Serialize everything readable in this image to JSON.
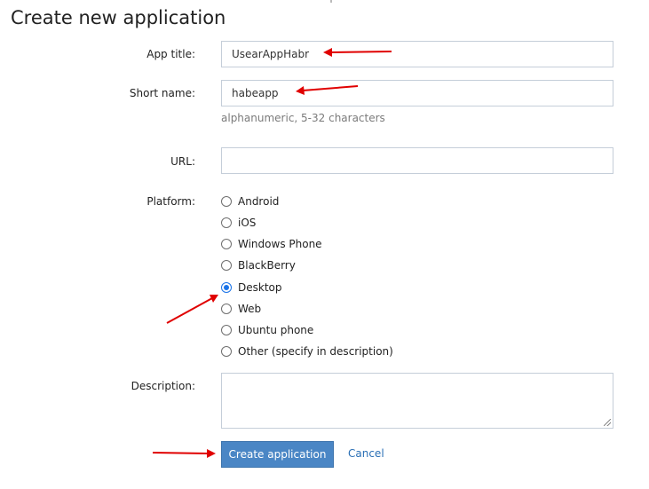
{
  "page": {
    "title": "Create new application"
  },
  "form": {
    "app_title": {
      "label": "App title:",
      "value": "UsearAppHabr"
    },
    "short_name": {
      "label": "Short name:",
      "value": "habeapp",
      "hint": "alphanumeric, 5-32 characters"
    },
    "url": {
      "label": "URL:",
      "value": ""
    },
    "platform": {
      "label": "Platform:",
      "options": [
        "Android",
        "iOS",
        "Windows Phone",
        "BlackBerry",
        "Desktop",
        "Web",
        "Ubuntu phone",
        "Other (specify in description)"
      ],
      "selected": "Desktop"
    },
    "description": {
      "label": "Description:",
      "value": ""
    },
    "submit_label": "Create application",
    "cancel_label": "Cancel"
  },
  "colors": {
    "accent": "#4a86c5",
    "link": "#2a6fb5",
    "annotation_arrow": "#e00000"
  }
}
